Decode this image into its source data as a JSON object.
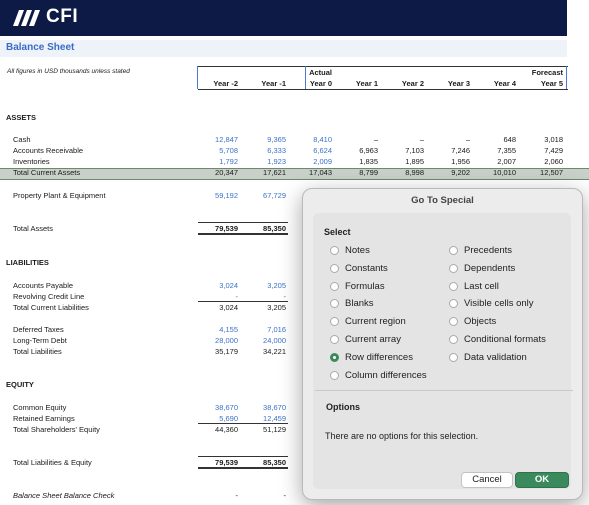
{
  "brand": {
    "logo_text": "CFI",
    "logo_icon": "cfi-slashes-icon"
  },
  "sheet": {
    "title": "Balance Sheet",
    "note": "All figures in USD thousands unless stated",
    "actual_label": "Actual",
    "forecast_label": "Forecast",
    "columns": [
      "Year -2",
      "Year -1",
      "Year 0",
      "Year 1",
      "Year 2",
      "Year 3",
      "Year 4",
      "Year 5"
    ],
    "sections": {
      "assets": "ASSETS",
      "liabilities": "LIABILITIES",
      "equity": "EQUITY"
    },
    "rows": {
      "cash": {
        "label": "Cash",
        "values": [
          "12,847",
          "9,365",
          "8,410",
          "–",
          "–",
          "–",
          "648",
          "3,018"
        ]
      },
      "ar": {
        "label": "Accounts Receivable",
        "values": [
          "5,708",
          "6,333",
          "6,624",
          "6,963",
          "7,103",
          "7,246",
          "7,355",
          "7,429"
        ]
      },
      "inv": {
        "label": "Inventories",
        "values": [
          "1,792",
          "1,923",
          "2,009",
          "1,835",
          "1,895",
          "1,956",
          "2,007",
          "2,060"
        ]
      },
      "tca": {
        "label": "Total Current Assets",
        "values": [
          "20,347",
          "17,621",
          "17,043",
          "8,799",
          "8,998",
          "9,202",
          "10,010",
          "12,507"
        ]
      },
      "ppe": {
        "label": "Property Plant & Equipment",
        "values": [
          "59,192",
          "67,729"
        ]
      },
      "ta": {
        "label": "Total Assets",
        "values": [
          "79,539",
          "85,350"
        ]
      },
      "ap": {
        "label": "Accounts Payable",
        "values": [
          "3,024",
          "3,205"
        ]
      },
      "rcl": {
        "label": "Revolving Credit Line",
        "values": [
          "-",
          "-"
        ]
      },
      "tcl": {
        "label": "Total Current Liabilities",
        "values": [
          "3,024",
          "3,205"
        ]
      },
      "dt": {
        "label": "Deferred Taxes",
        "values": [
          "4,155",
          "7,016"
        ]
      },
      "ltd": {
        "label": "Long-Term Debt",
        "values": [
          "28,000",
          "24,000"
        ]
      },
      "tl": {
        "label": "Total Liabilities",
        "values": [
          "35,179",
          "34,221"
        ]
      },
      "ce": {
        "label": "Common Equity",
        "values": [
          "38,670",
          "38,670"
        ]
      },
      "re": {
        "label": "Retained Earnings",
        "values": [
          "5,690",
          "12,459"
        ]
      },
      "tse": {
        "label": "Total Shareholders' Equity",
        "values": [
          "44,360",
          "51,129"
        ]
      },
      "tle": {
        "label": "Total Liabilities & Equity",
        "values": [
          "79,539",
          "85,350"
        ]
      },
      "check": {
        "label": "Balance Sheet Balance Check",
        "values": [
          "-",
          "-"
        ]
      }
    }
  },
  "dialog": {
    "title": "Go To Special",
    "select_label": "Select",
    "options_left": [
      "Notes",
      "Constants",
      "Formulas",
      "Blanks",
      "Current region",
      "Current array",
      "Row differences",
      "Column differences"
    ],
    "options_right": [
      "Precedents",
      "Dependents",
      "Last cell",
      "Visible cells only",
      "Objects",
      "Conditional formats",
      "Data validation"
    ],
    "selected": "Row differences",
    "options_heading": "Options",
    "options_message": "There are no options for this selection.",
    "cancel_label": "Cancel",
    "ok_label": "OK",
    "accent_color": "#3b8a5e"
  }
}
